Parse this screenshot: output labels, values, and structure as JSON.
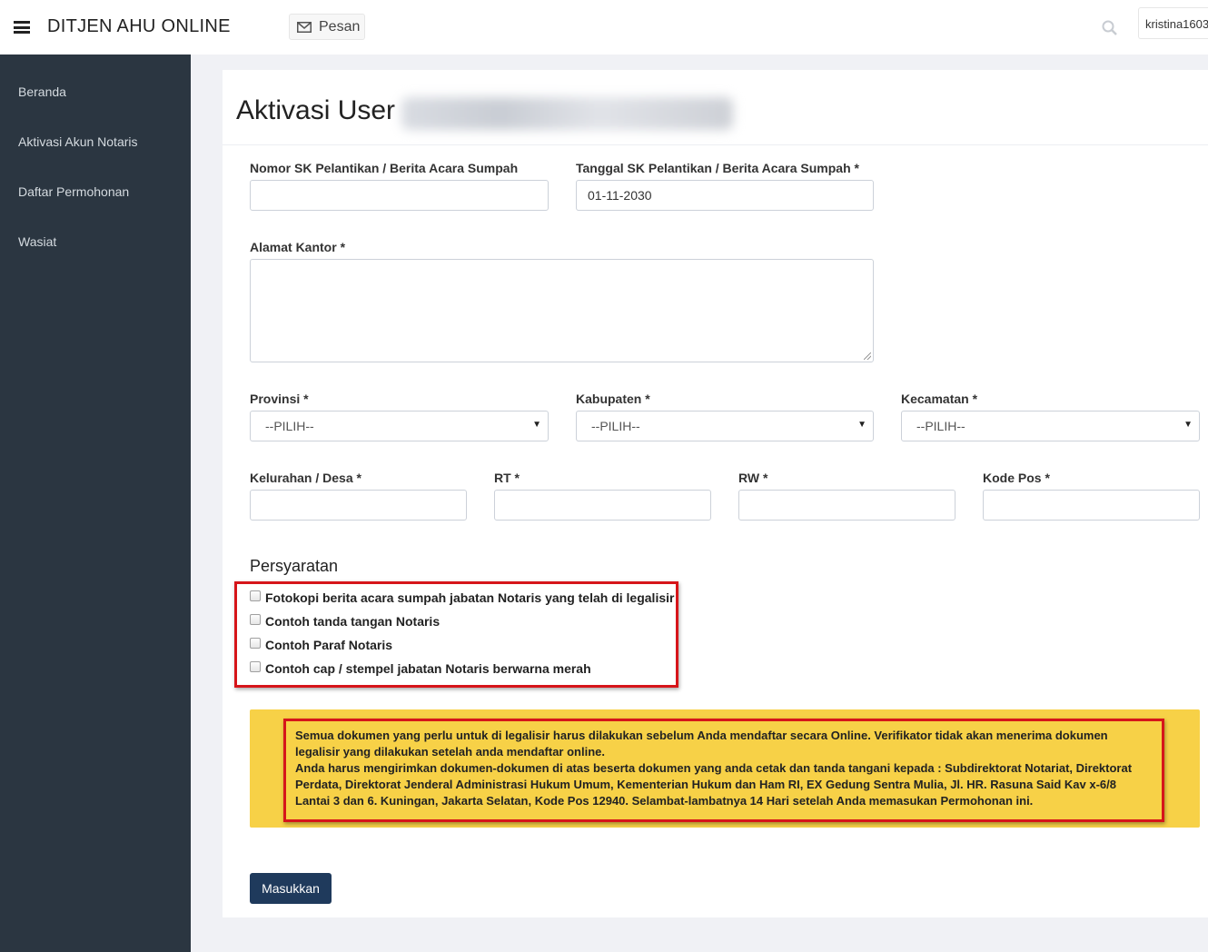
{
  "header": {
    "app_title": "DITJEN AHU ONLINE",
    "message_button": "Pesan",
    "username": "kristina1603"
  },
  "sidebar": {
    "items": [
      {
        "label": "Beranda"
      },
      {
        "label": "Aktivasi Akun Notaris"
      },
      {
        "label": "Daftar Permohonan"
      },
      {
        "label": "Wasiat"
      }
    ]
  },
  "page": {
    "title": "Aktivasi User"
  },
  "form": {
    "nomor_sk": {
      "label": "Nomor SK Pelantikan / Berita Acara Sumpah",
      "value": ""
    },
    "tanggal_sk": {
      "label": "Tanggal SK Pelantikan / Berita Acara Sumpah *",
      "value": "01-11-2030"
    },
    "alamat": {
      "label": "Alamat Kantor *",
      "value": ""
    },
    "provinsi": {
      "label": "Provinsi *",
      "selected": "--PILIH--"
    },
    "kabupaten": {
      "label": "Kabupaten *",
      "selected": "--PILIH--"
    },
    "kecamatan": {
      "label": "Kecamatan *",
      "selected": "--PILIH--"
    },
    "kelurahan": {
      "label": "Kelurahan / Desa *",
      "value": ""
    },
    "rt": {
      "label": "RT *",
      "value": ""
    },
    "rw": {
      "label": "RW *",
      "value": ""
    },
    "kode_pos": {
      "label": "Kode Pos *",
      "value": ""
    }
  },
  "requirements": {
    "title": "Persyaratan",
    "items": [
      {
        "label": "Fotokopi berita acara sumpah jabatan Notaris yang telah di legalisir",
        "checked": false
      },
      {
        "label": "Contoh tanda tangan Notaris",
        "checked": false
      },
      {
        "label": "Contoh Paraf Notaris",
        "checked": false
      },
      {
        "label": "Contoh cap / stempel jabatan Notaris berwarna merah",
        "checked": false
      }
    ]
  },
  "notice": {
    "line1": "Semua dokumen yang perlu untuk di legalisir harus dilakukan sebelum Anda mendaftar secara Online. Verifikator tidak akan menerima dokumen legalisir yang dilakukan setelah anda mendaftar online.",
    "line2": "Anda harus mengirimkan dokumen-dokumen di atas beserta dokumen yang anda cetak dan tanda tangani kepada : Subdirektorat Notariat, Direktorat Perdata, Direktorat Jenderal Administrasi Hukum Umum, Kementerian Hukum dan Ham RI, EX Gedung Sentra Mulia, Jl. HR. Rasuna Said Kav x-6/8 Lantai 3 dan 6. Kuningan, Jakarta Selatan, Kode Pos 12940. Selambat-lambatnya 14 Hari setelah Anda memasukan Permohonan ini."
  },
  "submit_label": "Masukkan",
  "colors": {
    "sidebar_bg": "#2b3641",
    "notice_bg": "#f7d147",
    "highlight_border": "#d6151a",
    "submit_bg": "#1f3a5c"
  },
  "icons": [
    "menu-icon",
    "envelope-icon",
    "search-icon",
    "dropdown-arrow-icon"
  ]
}
